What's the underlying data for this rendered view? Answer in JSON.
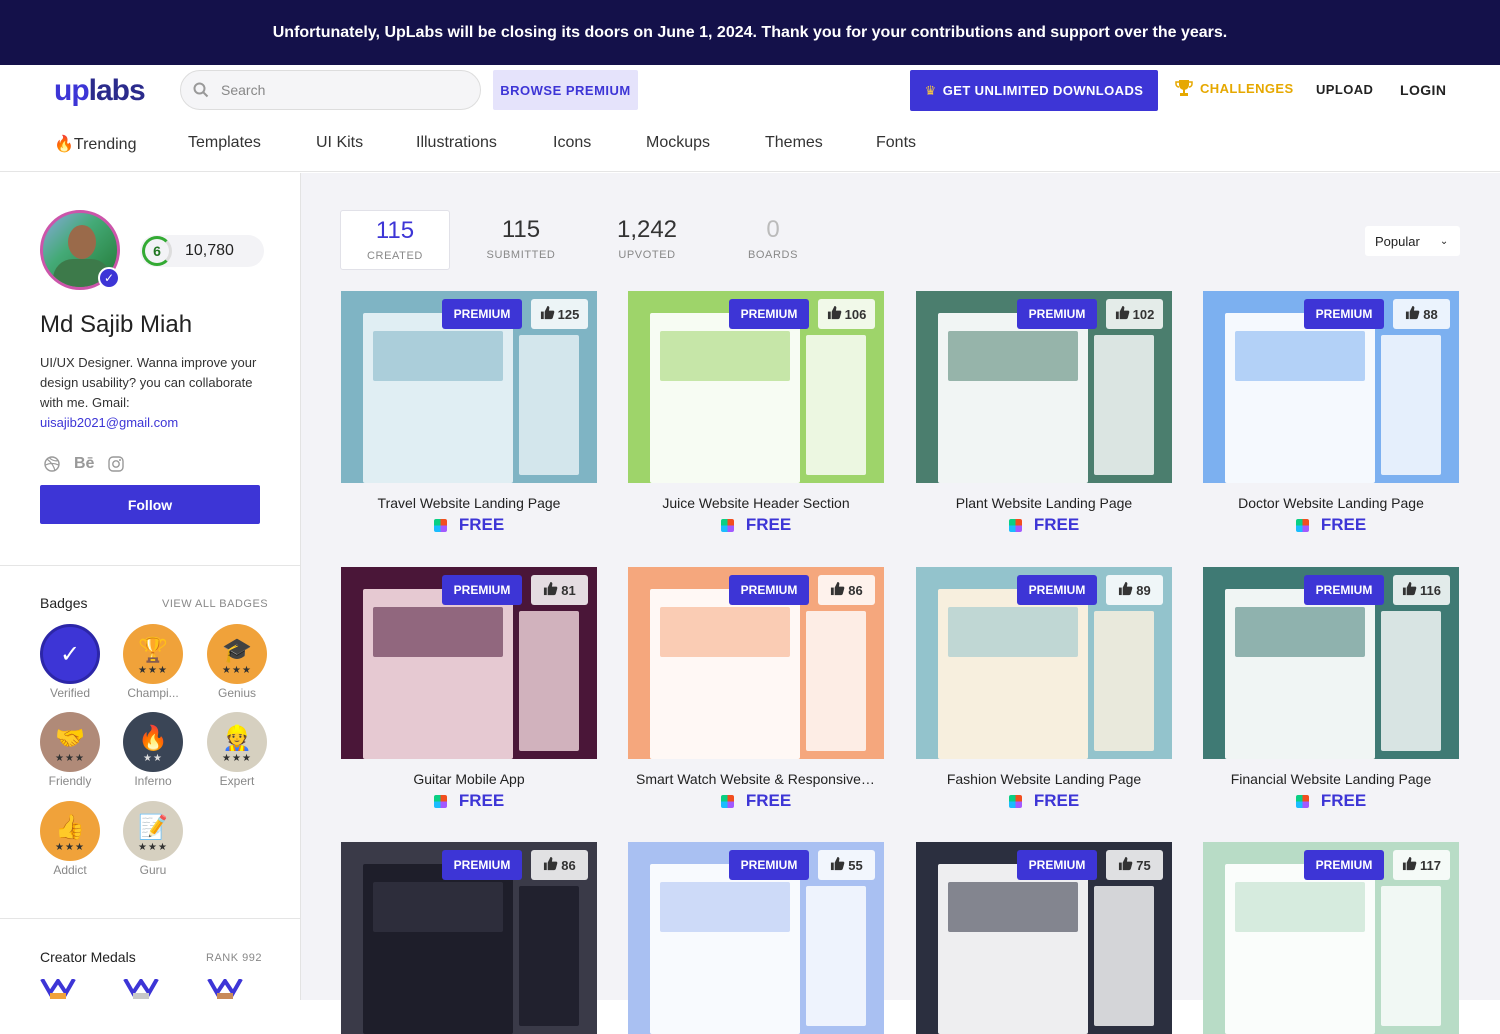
{
  "banner": {
    "text": "Unfortunately, UpLabs will be closing its doors on June 1, 2024. Thank you for your contributions and support over the years."
  },
  "header": {
    "logo_up": "up",
    "logo_labs": "labs",
    "search_placeholder": "Search",
    "browse_premium": "BROWSE PREMIUM",
    "get_unlimited": "GET UNLIMITED DOWNLOADS",
    "challenges": "CHALLENGES",
    "upload": "UPLOAD",
    "login": "LOGIN"
  },
  "categories": [
    "Trending",
    "Templates",
    "UI Kits",
    "Illustrations",
    "Icons",
    "Mockups",
    "Themes",
    "Fonts"
  ],
  "profile": {
    "level": "6",
    "points": "10,780",
    "name": "Md Sajib Miah",
    "bio": "UI/UX Designer. Wanna improve your design usability? you can collaborate with me. Gmail:",
    "email": "uisajib2021@gmail.com",
    "follow": "Follow"
  },
  "badges_section": {
    "title": "Badges",
    "view_all": "VIEW ALL BADGES",
    "items": [
      {
        "label": "Verified",
        "icon": "check-icon",
        "color": "#3d35d6",
        "stars": ""
      },
      {
        "label": "Champi...",
        "icon": "trophy-icon",
        "color": "#f0a23a",
        "stars": "★★★"
      },
      {
        "label": "Genius",
        "icon": "graduation-cap-icon",
        "color": "#f0a23a",
        "stars": "★★★"
      },
      {
        "label": "Friendly",
        "icon": "handshake-icon",
        "color": "#b08a78",
        "stars": "★★★"
      },
      {
        "label": "Inferno",
        "icon": "fire-icon",
        "color": "#3a4556",
        "stars": "★★"
      },
      {
        "label": "Expert",
        "icon": "expert-icon",
        "color": "#d6d0c0",
        "stars": "★★★"
      },
      {
        "label": "Addict",
        "icon": "thumbs-up-icon",
        "color": "#f0a23a",
        "stars": "★★★"
      },
      {
        "label": "Guru",
        "icon": "notepad-icon",
        "color": "#d6d0c0",
        "stars": "★★★"
      }
    ]
  },
  "medals_section": {
    "title": "Creator Medals",
    "rank": "RANK 992"
  },
  "stats": [
    {
      "value": "115",
      "label": "CREATED"
    },
    {
      "value": "115",
      "label": "SUBMITTED"
    },
    {
      "value": "1,242",
      "label": "UPVOTED"
    },
    {
      "value": "0",
      "label": "BOARDS"
    }
  ],
  "sort": {
    "selected": "Popular"
  },
  "cards": [
    {
      "title": "Travel Website Landing Page",
      "likes": "125",
      "badge": "PREMIUM",
      "price": "FREE",
      "bg": "#7fb4c4",
      "accent": "#e8f3f6"
    },
    {
      "title": "Juice Website Header Section",
      "likes": "106",
      "badge": "PREMIUM",
      "price": "FREE",
      "bg": "#9ed46a",
      "accent": "#ffffff"
    },
    {
      "title": "Plant Website Landing Page",
      "likes": "102",
      "badge": "PREMIUM",
      "price": "FREE",
      "bg": "#4b7e6e",
      "accent": "#ffffff"
    },
    {
      "title": "Doctor Website Landing Page",
      "likes": "88",
      "badge": "PREMIUM",
      "price": "FREE",
      "bg": "#7cb0f0",
      "accent": "#ffffff"
    },
    {
      "title": "Guitar Mobile App",
      "likes": "81",
      "badge": "PREMIUM",
      "price": "FREE",
      "bg": "#4a1638",
      "accent": "#f3d9df"
    },
    {
      "title": "Smart Watch Website & Responsive ...",
      "likes": "86",
      "badge": "PREMIUM",
      "price": "FREE",
      "bg": "#f5a77d",
      "accent": "#ffffff"
    },
    {
      "title": "Fashion Website Landing Page",
      "likes": "89",
      "badge": "PREMIUM",
      "price": "FREE",
      "bg": "#93c3cc",
      "accent": "#fff3e0"
    },
    {
      "title": "Financial Website Landing Page",
      "likes": "116",
      "badge": "PREMIUM",
      "price": "FREE",
      "bg": "#3f7a74",
      "accent": "#ffffff"
    },
    {
      "title": "",
      "likes": "86",
      "badge": "PREMIUM",
      "price": "",
      "bg": "#3a3a48",
      "accent": "#1c1c28"
    },
    {
      "title": "",
      "likes": "55",
      "badge": "PREMIUM",
      "price": "",
      "bg": "#a9c0f2",
      "accent": "#ffffff"
    },
    {
      "title": "",
      "likes": "75",
      "badge": "PREMIUM",
      "price": "",
      "bg": "#2b2f3f",
      "accent": "#ffffff"
    },
    {
      "title": "",
      "likes": "117",
      "badge": "PREMIUM",
      "price": "",
      "bg": "#b8dcc6",
      "accent": "#ffffff"
    }
  ]
}
